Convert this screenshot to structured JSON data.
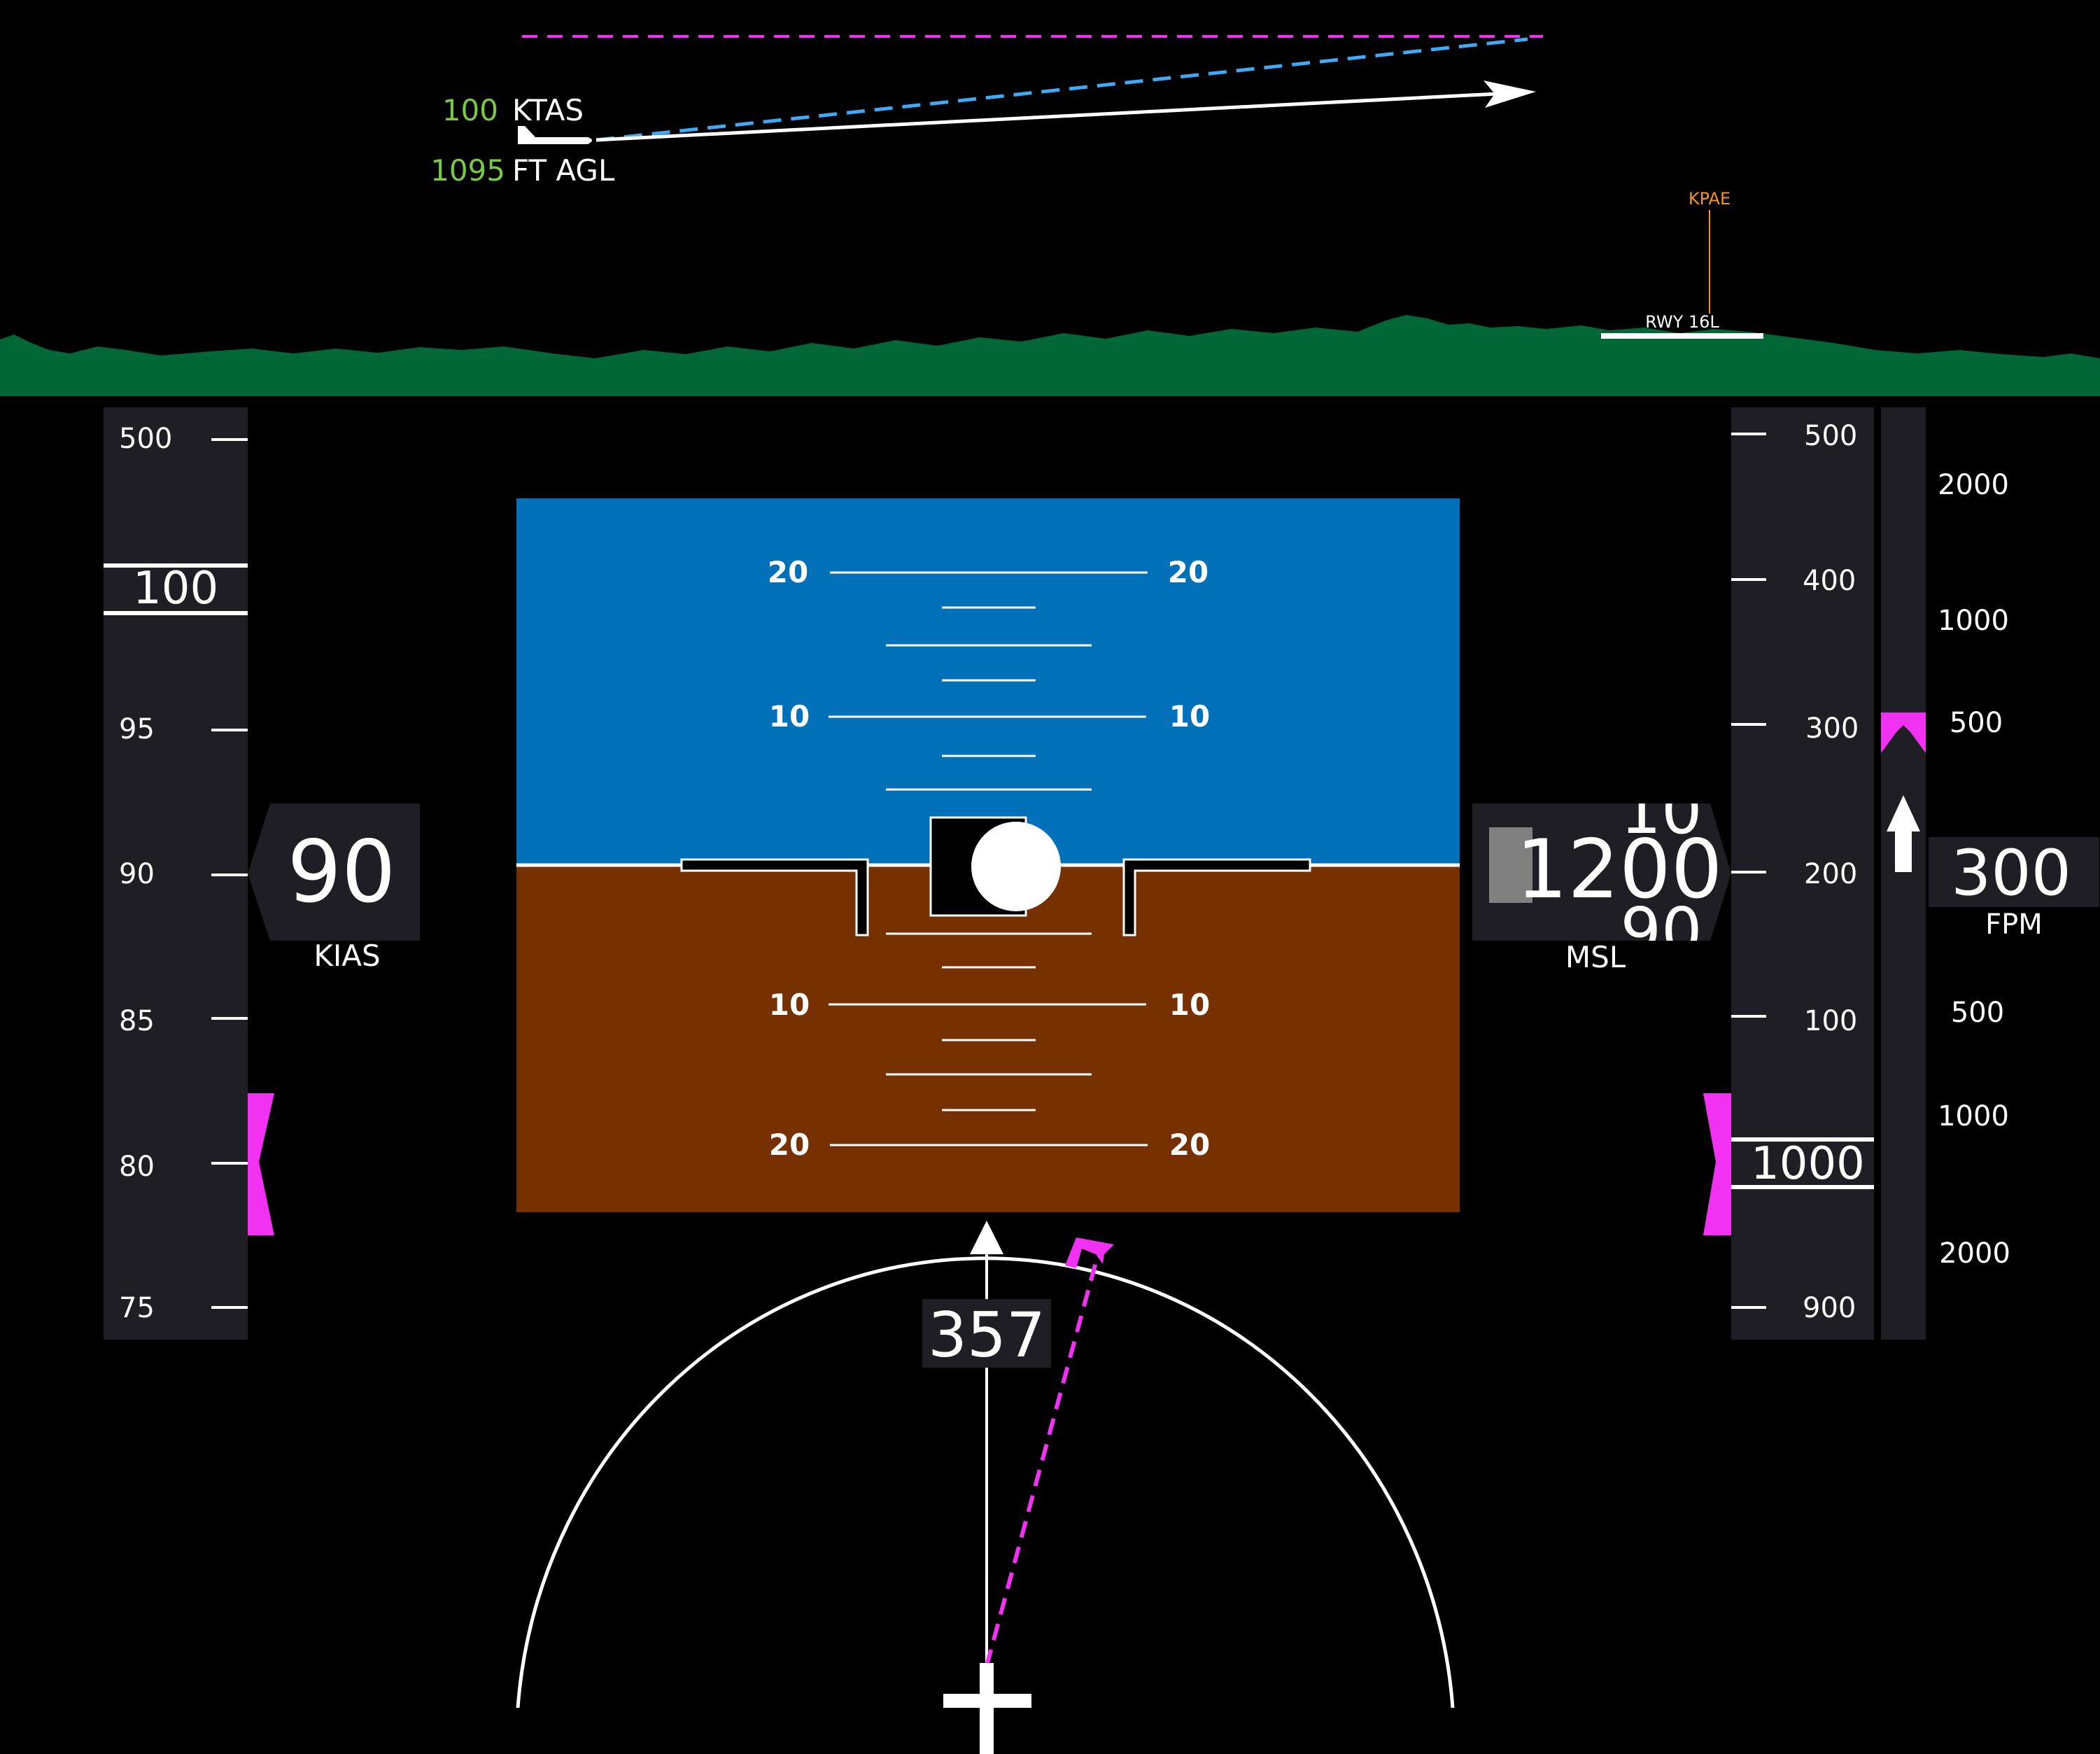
{
  "profile": {
    "speed_value": "100",
    "speed_unit": "KTAS",
    "agl_value": "1095",
    "agl_unit": "FT AGL",
    "airport": "KPAE",
    "runway": "RWY 16L"
  },
  "airspeed": {
    "ticks": [
      "500",
      "100",
      "95",
      "90",
      "85",
      "80",
      "75"
    ],
    "current": "90",
    "unit": "KIAS"
  },
  "altitude": {
    "ticks": [
      "500",
      "400",
      "300",
      "200",
      "100",
      "1000",
      "900"
    ],
    "drum_top": "10",
    "current": "1200",
    "drum_bottom": "90",
    "unit": "MSL"
  },
  "vsi": {
    "ticks": [
      "2000",
      "1000",
      "500",
      "500",
      "1000",
      "2000"
    ],
    "current": "300",
    "unit": "FPM",
    "bug_fpm": 500,
    "trend_fpm": 300
  },
  "attitude": {
    "pitch_labels": [
      "20",
      "20",
      "10",
      "10",
      "10",
      "10",
      "20",
      "20"
    ],
    "sky_color": "#0070b8",
    "ground_color": "#773000"
  },
  "heading": {
    "current": "357"
  },
  "colors": {
    "magenta": "#f232f2",
    "terrain": "#006837",
    "green_text": "#7ac943",
    "orange": "#f7931e",
    "tape": "#1e1e24"
  }
}
